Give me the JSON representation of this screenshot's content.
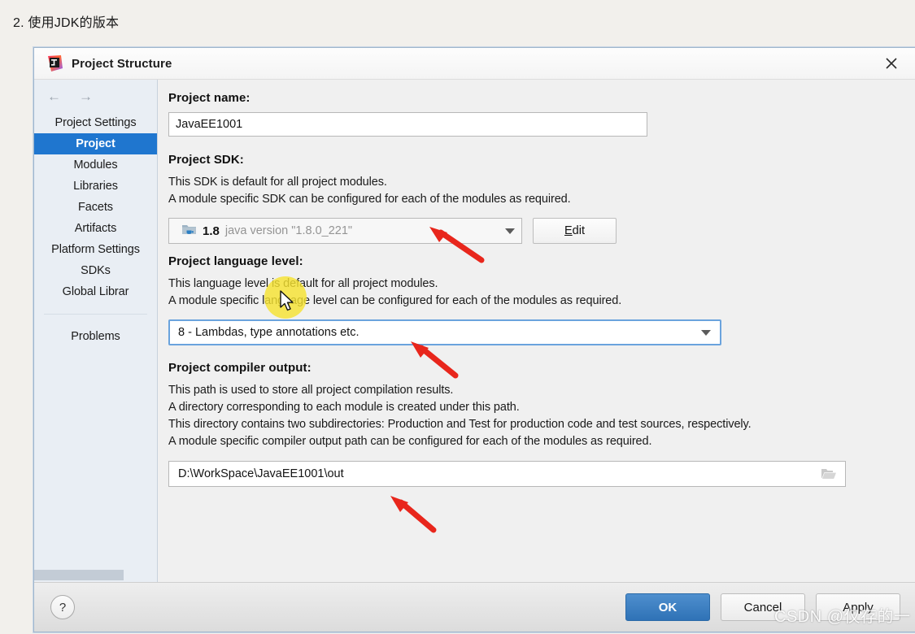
{
  "page": {
    "heading": "2. 使用JDK的版本"
  },
  "dialog": {
    "title": "Project Structure",
    "app_icon": "intellij-idea-icon",
    "close_icon": "close-icon"
  },
  "sidebar": {
    "back_icon": "arrow-left-icon",
    "forward_icon": "arrow-right-icon",
    "groups": [
      {
        "label": "Project Settings",
        "items": [
          {
            "label": "Project",
            "selected": true
          },
          {
            "label": "Modules",
            "selected": false
          },
          {
            "label": "Libraries",
            "selected": false
          },
          {
            "label": "Facets",
            "selected": false
          },
          {
            "label": "Artifacts",
            "selected": false
          }
        ]
      },
      {
        "label": "Platform Settings",
        "items": [
          {
            "label": "SDKs",
            "selected": false
          },
          {
            "label": "Global Librar",
            "selected": false
          }
        ]
      }
    ],
    "other_items": [
      {
        "label": "Problems",
        "selected": false
      }
    ]
  },
  "main": {
    "project_name": {
      "label": "Project name:",
      "value": "JavaEE1001"
    },
    "project_sdk": {
      "label": "Project SDK:",
      "desc_line1": "This SDK is default for all project modules.",
      "desc_line2": "A module specific SDK can be configured for each of the modules as required.",
      "icon": "sdk-folder-java-icon",
      "version": "1.8",
      "detail": "java version \"1.8.0_221\"",
      "dropdown_icon": "chevron-down-icon",
      "edit_button": "Edit",
      "edit_button_mnemonic": "E",
      "edit_button_rest": "dit"
    },
    "language_level": {
      "label": "Project language level:",
      "desc_line1": "This language level is default for all project modules.",
      "desc_line2": "A module specific language level can be configured for each of the modules as required.",
      "value": "8 - Lambdas, type annotations etc.",
      "dropdown_icon": "chevron-down-icon"
    },
    "compiler_output": {
      "label": "Project compiler output:",
      "desc_line1": "This path is used to store all project compilation results.",
      "desc_line2": "A directory corresponding to each module is created under this path.",
      "desc_line3": "This directory contains two subdirectories: Production and Test for production code and test sources, respectively.",
      "desc_line4": "A module specific compiler output path can be configured for each of the modules as required.",
      "value": "D:\\WorkSpace\\JavaEE1001\\out",
      "browse_icon": "folder-open-icon"
    }
  },
  "footer": {
    "help_label": "?",
    "ok_label": "OK",
    "cancel_label": "Cancel",
    "apply_label": "Apply"
  },
  "annotations": {
    "watermark": "CSDN @仅存的一",
    "arrow_color": "#e8261c",
    "highlight_color": "#f5e231",
    "arrows": [
      {
        "name": "arrow-to-sdk-dropdown"
      },
      {
        "name": "arrow-to-language-level"
      },
      {
        "name": "arrow-to-compiler-output"
      }
    ]
  },
  "colors": {
    "selection_blue": "#1f76cf",
    "ok_button_blue": "#2f72b6",
    "focus_border": "#6aa3dd",
    "sidebar_bg": "#e9eef4",
    "dialog_bg": "#f0f0f0"
  }
}
